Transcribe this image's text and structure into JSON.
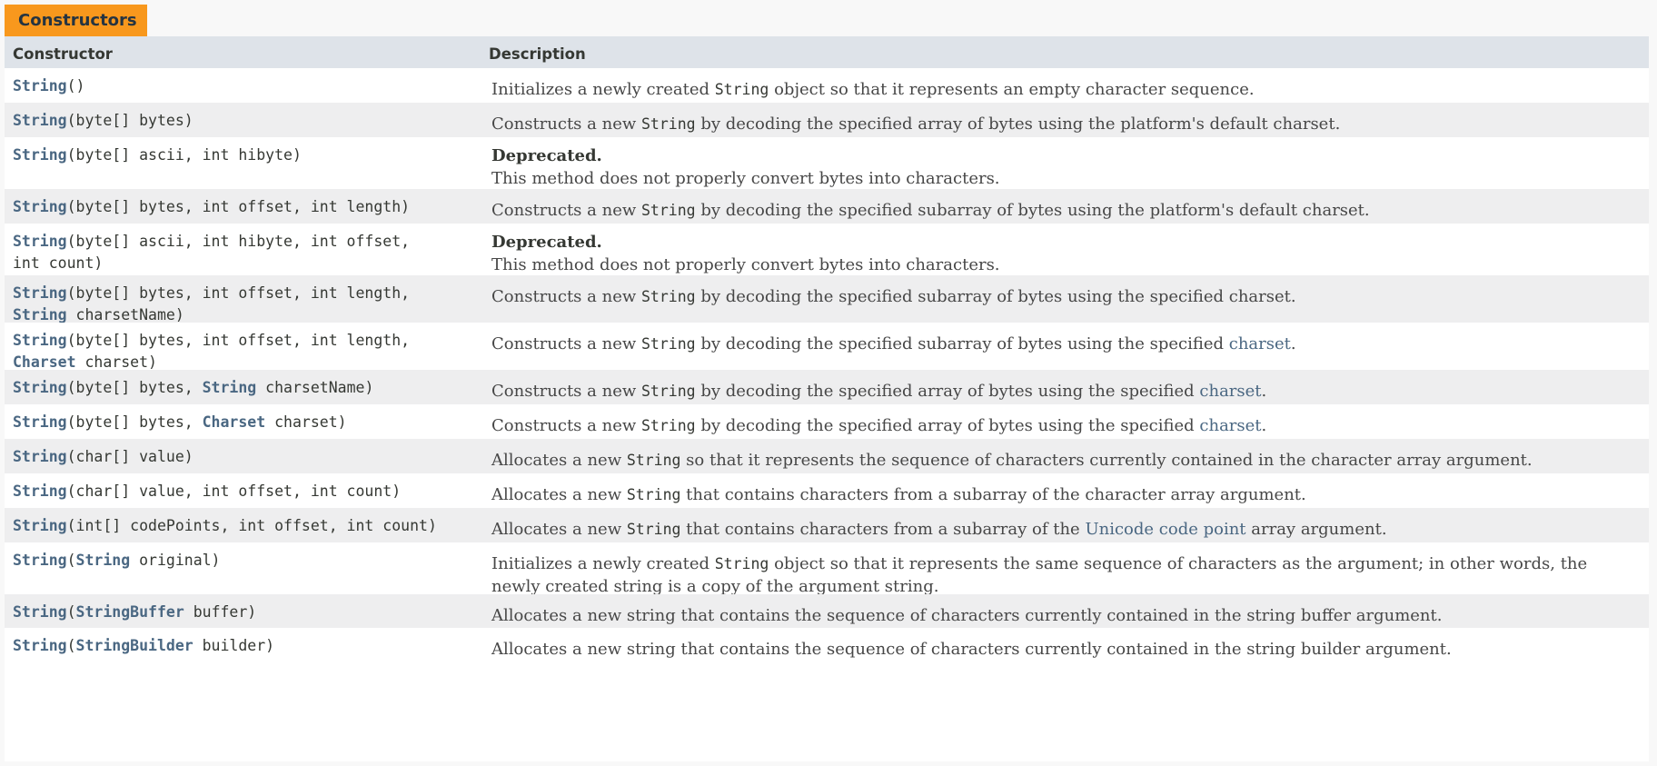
{
  "section": {
    "caption": "Constructors"
  },
  "table": {
    "headers": {
      "constructor": "Constructor",
      "description": "Description"
    }
  },
  "rows": [
    {
      "sig": [
        {
          "t": "String",
          "link": true
        },
        {
          "t": "()"
        }
      ],
      "desc": [
        {
          "t": "Initializes a newly created "
        },
        {
          "t": "String",
          "code": true
        },
        {
          "t": " object so that it represents an empty character sequence."
        }
      ]
    },
    {
      "sig": [
        {
          "t": "String",
          "link": true
        },
        {
          "t": "(byte[] bytes)"
        }
      ],
      "desc": [
        {
          "t": "Constructs a new "
        },
        {
          "t": "String",
          "code": true
        },
        {
          "t": " by decoding the specified array of bytes using the platform's default charset."
        }
      ]
    },
    {
      "sig": [
        {
          "t": "String",
          "link": true
        },
        {
          "t": "(byte[] ascii, int hibyte)"
        }
      ],
      "deprecated": "Deprecated.",
      "desc": [
        {
          "t": "This method does not properly convert bytes into characters."
        }
      ]
    },
    {
      "sig": [
        {
          "t": "String",
          "link": true
        },
        {
          "t": "(byte[] bytes, int offset, int length)"
        }
      ],
      "desc": [
        {
          "t": "Constructs a new "
        },
        {
          "t": "String",
          "code": true
        },
        {
          "t": " by decoding the specified subarray of bytes using the platform's default charset."
        }
      ]
    },
    {
      "sig": [
        {
          "t": "String",
          "link": true
        },
        {
          "t": "(byte[] ascii, int hibyte, int offset,\nint count)"
        }
      ],
      "deprecated": "Deprecated.",
      "desc": [
        {
          "t": "This method does not properly convert bytes into characters."
        }
      ]
    },
    {
      "sig": [
        {
          "t": "String",
          "link": true
        },
        {
          "t": "(byte[] bytes, int offset, int length,\n"
        },
        {
          "t": "String",
          "link": true
        },
        {
          "t": " charsetName)"
        }
      ],
      "desc": [
        {
          "t": "Constructs a new "
        },
        {
          "t": "String",
          "code": true
        },
        {
          "t": " by decoding the specified subarray of bytes using the specified charset."
        }
      ]
    },
    {
      "sig": [
        {
          "t": "String",
          "link": true
        },
        {
          "t": "(byte[] bytes, int offset, int length,\n"
        },
        {
          "t": "Charset",
          "link": true
        },
        {
          "t": " charset)"
        }
      ],
      "desc": [
        {
          "t": "Constructs a new "
        },
        {
          "t": "String",
          "code": true
        },
        {
          "t": " by decoding the specified subarray of bytes using the specified "
        },
        {
          "t": "charset",
          "link": true
        },
        {
          "t": "."
        }
      ]
    },
    {
      "sig": [
        {
          "t": "String",
          "link": true
        },
        {
          "t": "(byte[] bytes, "
        },
        {
          "t": "String",
          "link": true
        },
        {
          "t": " charsetName)"
        }
      ],
      "desc": [
        {
          "t": "Constructs a new "
        },
        {
          "t": "String",
          "code": true
        },
        {
          "t": " by decoding the specified array of bytes using the specified "
        },
        {
          "t": "charset",
          "link": true
        },
        {
          "t": "."
        }
      ]
    },
    {
      "sig": [
        {
          "t": "String",
          "link": true
        },
        {
          "t": "(byte[] bytes, "
        },
        {
          "t": "Charset",
          "link": true
        },
        {
          "t": " charset)"
        }
      ],
      "desc": [
        {
          "t": "Constructs a new "
        },
        {
          "t": "String",
          "code": true
        },
        {
          "t": " by decoding the specified array of bytes using the specified "
        },
        {
          "t": "charset",
          "link": true
        },
        {
          "t": "."
        }
      ]
    },
    {
      "sig": [
        {
          "t": "String",
          "link": true
        },
        {
          "t": "(char[] value)"
        }
      ],
      "desc": [
        {
          "t": "Allocates a new "
        },
        {
          "t": "String",
          "code": true
        },
        {
          "t": " so that it represents the sequence of characters currently contained in the character array argument."
        }
      ]
    },
    {
      "sig": [
        {
          "t": "String",
          "link": true
        },
        {
          "t": "(char[] value, int offset, int count)"
        }
      ],
      "desc": [
        {
          "t": "Allocates a new "
        },
        {
          "t": "String",
          "code": true
        },
        {
          "t": " that contains characters from a subarray of the character array argument."
        }
      ]
    },
    {
      "sig": [
        {
          "t": "String",
          "link": true
        },
        {
          "t": "(int[] codePoints, int offset, int count)"
        }
      ],
      "desc": [
        {
          "t": "Allocates a new "
        },
        {
          "t": "String",
          "code": true
        },
        {
          "t": " that contains characters from a subarray of the "
        },
        {
          "t": "Unicode code point",
          "link": true
        },
        {
          "t": " array argument."
        }
      ]
    },
    {
      "sig": [
        {
          "t": "String",
          "link": true
        },
        {
          "t": "("
        },
        {
          "t": "String",
          "link": true
        },
        {
          "t": " original)"
        }
      ],
      "desc": [
        {
          "t": "Initializes a newly created "
        },
        {
          "t": "String",
          "code": true
        },
        {
          "t": " object so that it represents the same sequence of characters as the argument; in other words, the newly created string is a copy of the argument string."
        }
      ]
    },
    {
      "sig": [
        {
          "t": "String",
          "link": true
        },
        {
          "t": "("
        },
        {
          "t": "StringBuffer",
          "link": true
        },
        {
          "t": " buffer)"
        }
      ],
      "desc": [
        {
          "t": "Allocates a new string that contains the sequence of characters currently contained in the string buffer argument."
        }
      ]
    },
    {
      "sig": [
        {
          "t": "String",
          "link": true
        },
        {
          "t": "("
        },
        {
          "t": "StringBuilder",
          "link": true
        },
        {
          "t": " builder)"
        }
      ],
      "desc": [
        {
          "t": "Allocates a new string that contains the sequence of characters currently contained in the string builder argument."
        }
      ]
    }
  ]
}
